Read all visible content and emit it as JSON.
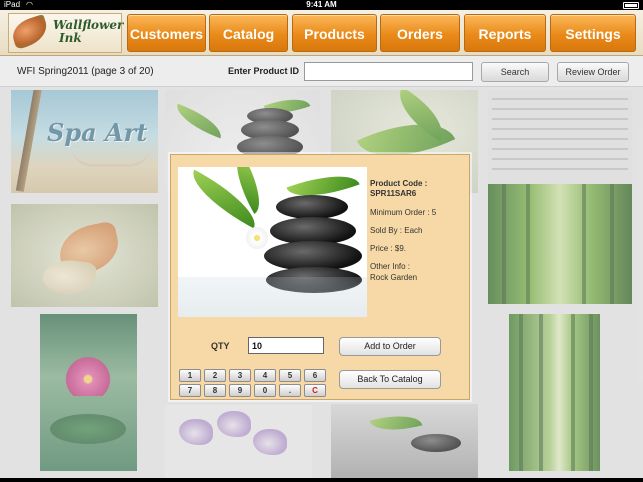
{
  "status_bar": {
    "device": "iPad",
    "time": "9:41 AM",
    "wifi_icon": "wifi-icon",
    "battery_icon": "battery-icon"
  },
  "brand": {
    "name_line1": "Wallflower",
    "name_line2": "Ink",
    "logo_icon": "leaf-logo-icon"
  },
  "nav": {
    "tabs": [
      {
        "label": "Customers"
      },
      {
        "label": "Catalog"
      },
      {
        "label": "Products"
      },
      {
        "label": "Orders"
      },
      {
        "label": "Reports"
      },
      {
        "label": "Settings"
      }
    ],
    "accent_color": "#e98a19"
  },
  "subbar": {
    "catalog_title": "WFI Spring2011 (page 3 of 20)",
    "product_id_label": "Enter Product ID",
    "product_id_value": "",
    "search_label": "Search",
    "review_order_label": "Review Order"
  },
  "gallery": {
    "featured_tile_text": "Spa Art"
  },
  "product_popup": {
    "code_label": "Product Code :",
    "code_value": "SPR11SAR6",
    "minimum_order": "Minimum Order : 5",
    "sold_by": "Sold By : Each",
    "price": "Price : $9.",
    "other_info_label": "Other Info :",
    "other_info_value": "Rock Garden",
    "qty_label": "QTY",
    "qty_value": "10",
    "add_to_order_label": "Add to Order",
    "back_to_catalog_label": "Back To Catalog",
    "background_color": "#f6d9a6"
  },
  "keypad": {
    "row1": [
      "1",
      "2",
      "3",
      "4",
      "5",
      "6"
    ],
    "row2": [
      "7",
      "8",
      "9",
      "0",
      ".",
      "C"
    ]
  }
}
